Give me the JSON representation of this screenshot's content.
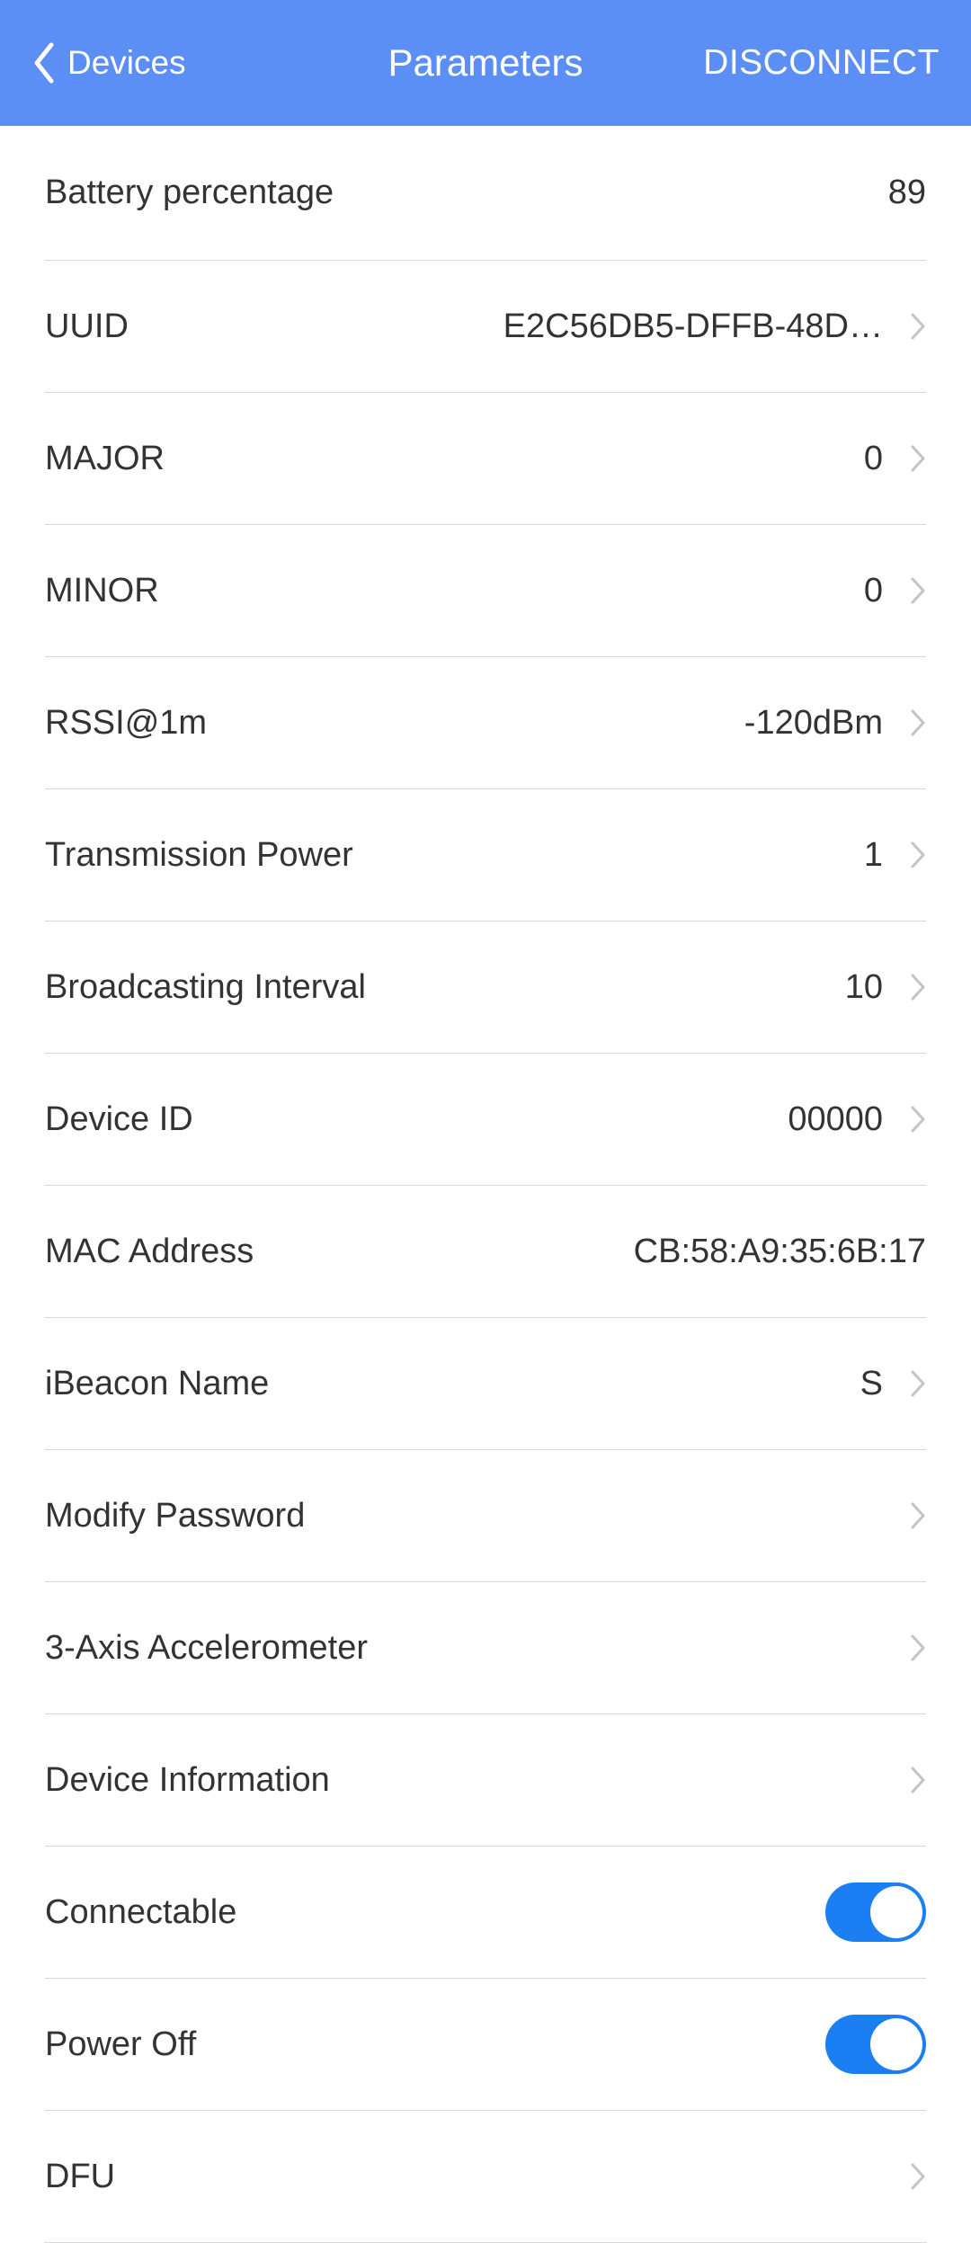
{
  "header": {
    "back_label": "Devices",
    "title": "Parameters",
    "action": "DISCONNECT"
  },
  "rows": {
    "battery": {
      "label": "Battery percentage",
      "value": "89"
    },
    "uuid": {
      "label": "UUID",
      "value": "E2C56DB5-DFFB-48D…"
    },
    "major": {
      "label": "MAJOR",
      "value": "0"
    },
    "minor": {
      "label": "MINOR",
      "value": "0"
    },
    "rssi": {
      "label": "RSSI@1m",
      "value": "-120dBm"
    },
    "txpower": {
      "label": "Transmission Power",
      "value": "1"
    },
    "broadcast": {
      "label": "Broadcasting Interval",
      "value": "10"
    },
    "deviceid": {
      "label": "Device ID",
      "value": "00000"
    },
    "mac": {
      "label": "MAC Address",
      "value": "CB:58:A9:35:6B:17"
    },
    "ibeacon": {
      "label": "iBeacon Name",
      "value": "S"
    },
    "password": {
      "label": "Modify Password"
    },
    "accel": {
      "label": "3-Axis Accelerometer"
    },
    "devinfo": {
      "label": "Device Information"
    },
    "connectable": {
      "label": "Connectable",
      "on": true
    },
    "poweroff": {
      "label": "Power Off",
      "on": true
    },
    "dfu": {
      "label": "DFU"
    }
  }
}
